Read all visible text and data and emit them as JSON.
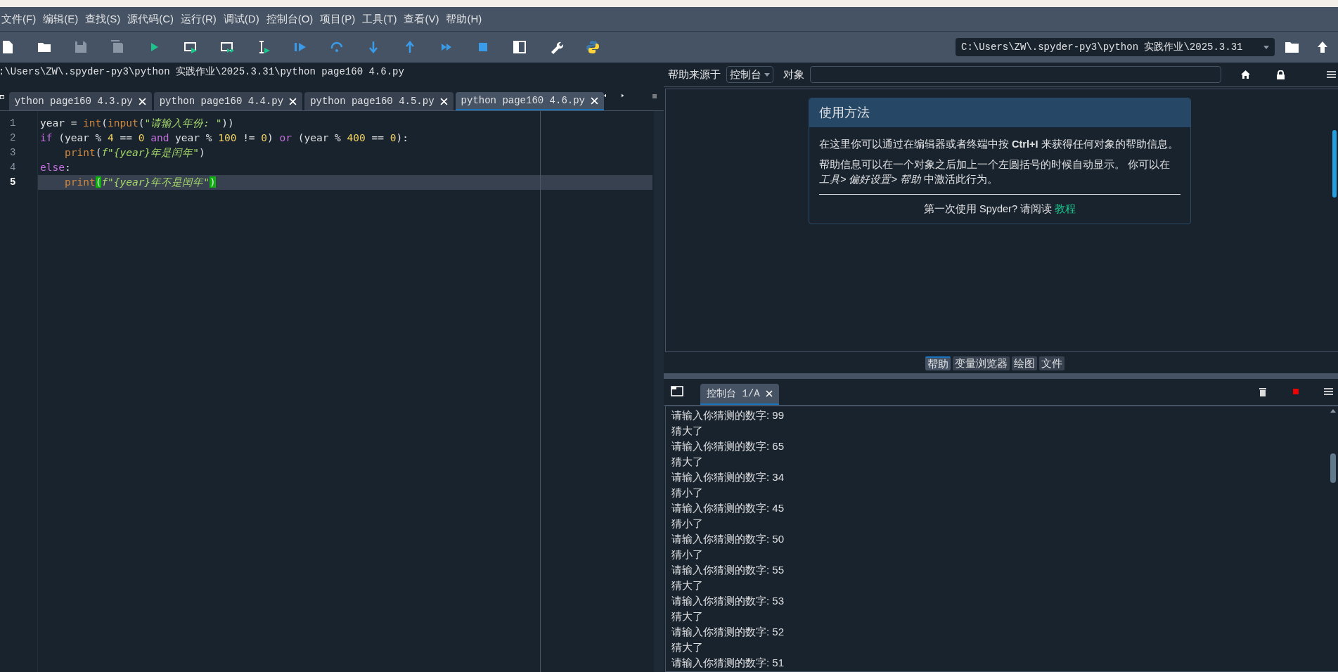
{
  "menu": [
    "文件(F)",
    "编辑(E)",
    "查找(S)",
    "源代码(C)",
    "运行(R)",
    "调试(D)",
    "控制台(O)",
    "项目(P)",
    "工具(T)",
    "查看(V)",
    "帮助(H)"
  ],
  "working_directory": "C:\\Users\\ZW\\.spyder-py3\\python 实践作业\\2025.3.31",
  "editor": {
    "file_path": ":\\Users\\ZW\\.spyder-py3\\python 实践作业\\2025.3.31\\python page160 4.6.py",
    "tabs": [
      {
        "label": "ython page160 4.3.py",
        "selected": false
      },
      {
        "label": "python page160 4.4.py",
        "selected": false
      },
      {
        "label": "python page160 4.5.py",
        "selected": false
      },
      {
        "label": "python page160 4.6.py",
        "selected": true
      }
    ],
    "lines": [
      {
        "number": "1",
        "current": false,
        "tokens": [
          {
            "kind": "plain",
            "text": "year = "
          },
          {
            "kind": "builtin",
            "text": "int"
          },
          {
            "kind": "plain",
            "text": "("
          },
          {
            "kind": "builtin",
            "text": "input"
          },
          {
            "kind": "plain",
            "text": "("
          },
          {
            "kind": "string",
            "text": "\"请输入年份: \""
          },
          {
            "kind": "plain",
            "text": "))"
          }
        ]
      },
      {
        "number": "2",
        "current": false,
        "tokens": [
          {
            "kind": "keyword",
            "text": "if"
          },
          {
            "kind": "plain",
            "text": " (year % "
          },
          {
            "kind": "number",
            "text": "4"
          },
          {
            "kind": "plain",
            "text": " == "
          },
          {
            "kind": "number",
            "text": "0"
          },
          {
            "kind": "keyword",
            "text": " and"
          },
          {
            "kind": "plain",
            "text": " year % "
          },
          {
            "kind": "number",
            "text": "100"
          },
          {
            "kind": "plain",
            "text": " != "
          },
          {
            "kind": "number",
            "text": "0"
          },
          {
            "kind": "plain",
            "text": ") "
          },
          {
            "kind": "keyword",
            "text": "or"
          },
          {
            "kind": "plain",
            "text": " (year % "
          },
          {
            "kind": "number",
            "text": "400"
          },
          {
            "kind": "plain",
            "text": " == "
          },
          {
            "kind": "number",
            "text": "0"
          },
          {
            "kind": "plain",
            "text": "):"
          }
        ]
      },
      {
        "number": "3",
        "current": false,
        "indented": true,
        "tokens": [
          {
            "kind": "builtin",
            "text": "print"
          },
          {
            "kind": "plain",
            "text": "("
          },
          {
            "kind": "string",
            "text": "f\"{year}年是闰年\""
          },
          {
            "kind": "plain",
            "text": ")"
          }
        ]
      },
      {
        "number": "4",
        "current": false,
        "tokens": [
          {
            "kind": "keyword",
            "text": "else"
          },
          {
            "kind": "plain",
            "text": ":"
          }
        ]
      },
      {
        "number": "5",
        "current": true,
        "indented": true,
        "tokens": [
          {
            "kind": "builtin",
            "text": "print"
          },
          {
            "kind": "match",
            "text": "("
          },
          {
            "kind": "string",
            "text": "f\"{year}年不是闰年\""
          },
          {
            "kind": "match",
            "text": ")"
          }
        ]
      }
    ]
  },
  "help": {
    "source_label": "帮助来源于",
    "source_value": "控制台",
    "object_label": "对象",
    "card_title": "使用方法",
    "paragraphs": [
      [
        {
          "kind": "plain",
          "text": "在这里你可以通过在编辑器或者终端中按 "
        },
        {
          "kind": "key",
          "text": "Ctrl+I"
        },
        {
          "kind": "plain",
          "text": " 来获得任何对象的帮助信息。"
        }
      ],
      [
        {
          "kind": "plain",
          "text": "帮助信息可以在一个对象之后加上一个左圆括号的时候自动显示。 你可以在"
        },
        {
          "kind": "menu_path",
          "text": "工具> 偏好设置> 帮助"
        },
        {
          "kind": "plain",
          "text": " 中激活此行为。"
        }
      ]
    ],
    "footer_text": "第一次使用 Spyder? 请阅读",
    "footer_link": "教程",
    "tabs": [
      {
        "label": "帮助",
        "selected": true
      },
      {
        "label": "变量浏览器",
        "selected": false
      },
      {
        "label": "绘图",
        "selected": false
      },
      {
        "label": "文件",
        "selected": false
      }
    ]
  },
  "console": {
    "tab": "控制台 1/A",
    "lines": [
      "请输入你猜测的数字: 99",
      "猜大了",
      "请输入你猜测的数字: 65",
      "猜大了",
      "请输入你猜测的数字: 34",
      "猜小了",
      "请输入你猜测的数字: 45",
      "猜小了",
      "请输入你猜测的数字: 50",
      "猜小了",
      "请输入你猜测的数字: 55",
      "猜大了",
      "请输入你猜测的数字: 53",
      "猜大了",
      "请输入你猜测的数字: 52",
      "猜大了",
      "请输入你猜测的数字: 51"
    ]
  }
}
